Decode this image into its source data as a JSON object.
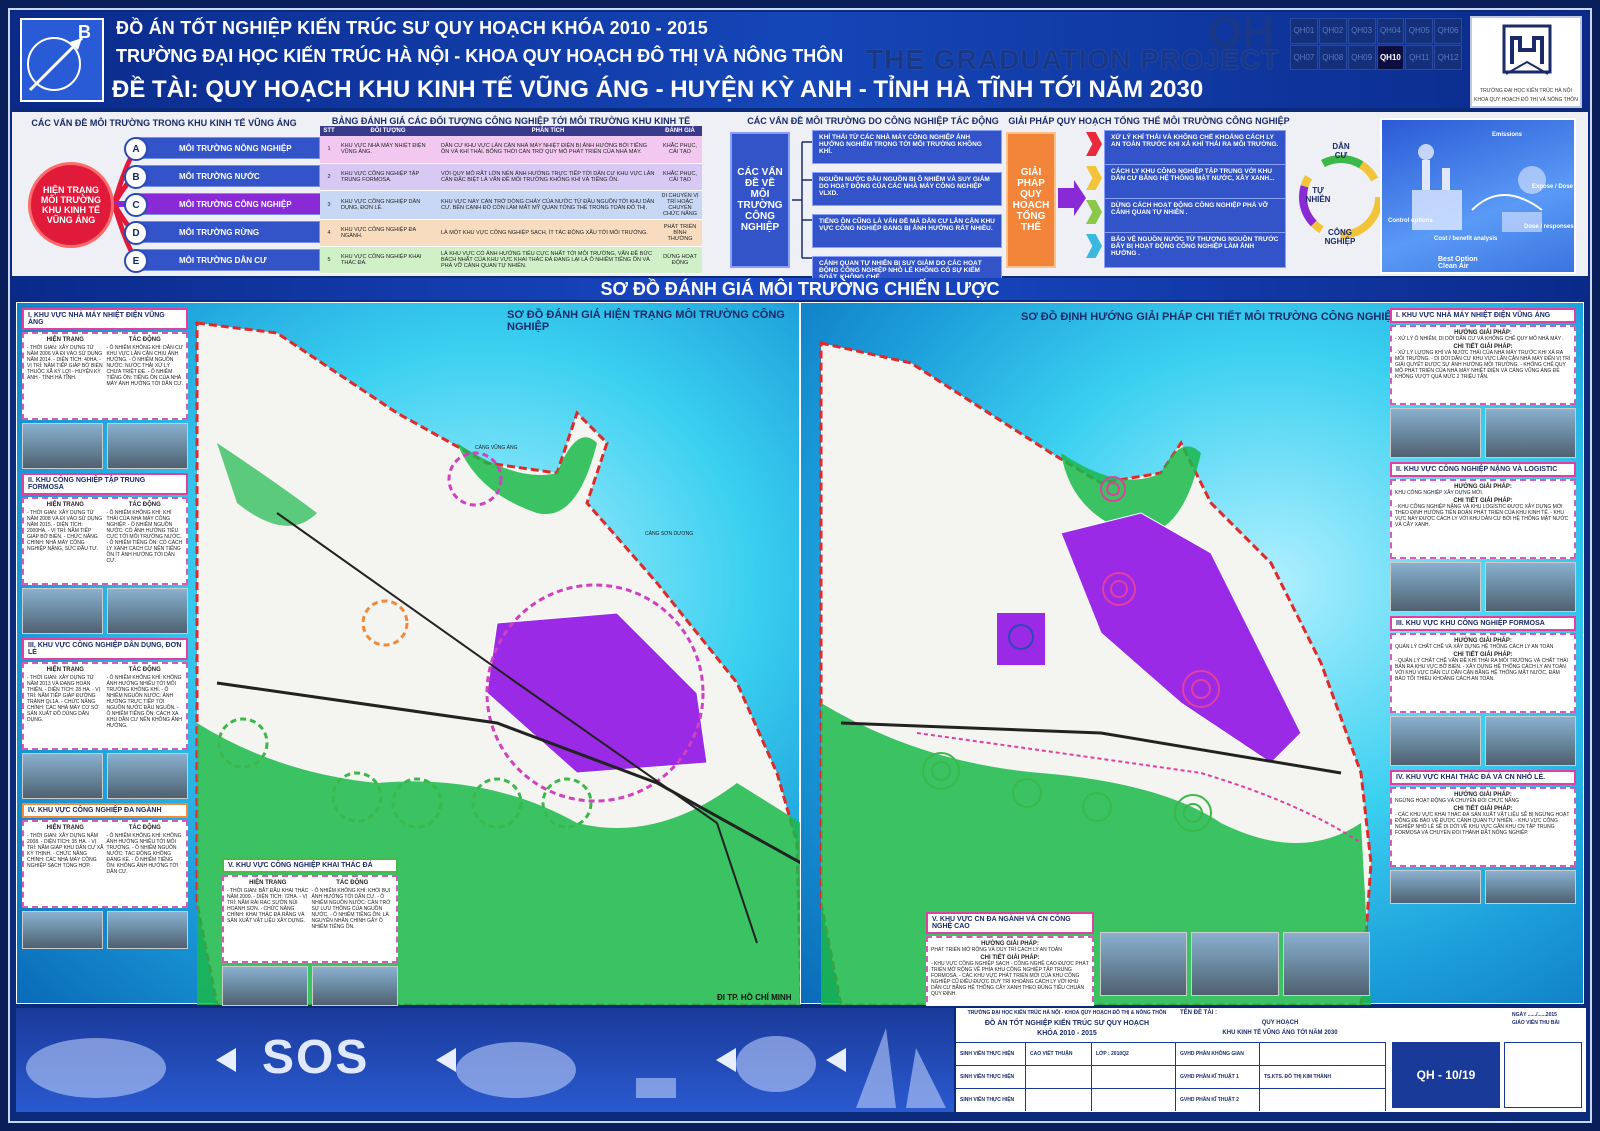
{
  "header": {
    "line1": "ĐỒ ÁN TỐT NGHIỆP KIẾN TRÚC SƯ QUY HOẠCH KHÓA 2010 - 2015",
    "line2": "TRƯỜNG ĐẠI HỌC KIẾN TRÚC HÀ NỘI - KHOA QUY HOẠCH ĐÔ THỊ VÀ NÔNG THÔN",
    "line3": "ĐỀ TÀI: QUY HOẠCH KHU KINH TẾ VŨNG ÁNG - HUYỆN KỲ ANH - TỈNH HÀ TĨNH TỚI NĂM 2030",
    "watermark": "THE GRADUATION PROJECT",
    "watermark_qh": "QH",
    "compass_letter": "B",
    "sheets": [
      "QH01",
      "QH02",
      "QH03",
      "QH04",
      "QH05",
      "QH06",
      "QH07",
      "QH08",
      "QH09",
      "QH10",
      "QH11",
      "QH12"
    ],
    "active_sheet": "QH10",
    "logo_caption1": "TRƯỜNG ĐẠI HỌC KIẾN TRÚC HÀ NỘI",
    "logo_caption2": "KHOA QUY HOẠCH ĐÔ THỊ VÀ NÔNG THÔN"
  },
  "issues_panel": {
    "title": "CÁC VẤN ĐỀ MÔI TRƯỜNG TRONG KHU KINH TẾ VŨNG ÁNG",
    "center": "HIỆN TRẠNG MÔI TRƯỜNG KHU KINH TẾ VŨNG ÁNG",
    "items": [
      {
        "letter": "A",
        "label": "MÔI TRƯỜNG NÔNG NGHIỆP"
      },
      {
        "letter": "B",
        "label": "MÔI TRƯỜNG NƯỚC"
      },
      {
        "letter": "C",
        "label": "MÔI TRƯỜNG CÔNG NGHIỆP"
      },
      {
        "letter": "D",
        "label": "MÔI TRƯỜNG RỪNG"
      },
      {
        "letter": "E",
        "label": "MÔI TRƯỜNG DÂN CƯ"
      }
    ]
  },
  "assessment_table": {
    "title": "BẢNG ĐÁNH GIÁ CÁC ĐỐI TƯỢNG CÔNG NGHIỆP TỚI MÔI TRƯỜNG KHU KINH TẾ VŨNG ÁNG",
    "headers": [
      "STT",
      "ĐỐI TƯỢNG",
      "PHÂN TÍCH",
      "ĐÁNH GIÁ"
    ],
    "rows": [
      {
        "stt": "1",
        "subject": "KHU VỰC NHÀ MÁY NHIỆT ĐIỆN VŨNG ÁNG.",
        "analysis": "DÂN CƯ KHU VỰC LÂN CẬN NHÀ MÁY NHIỆT ĐIỆN BỊ ẢNH HƯỞNG BỞI TIẾNG ỒN VÀ KHÍ THẢI. BỐNG THỜI CÁN TRỞ QUY MÔ PHÁT TRIỂN CỦA NHÀ MÁY.",
        "eval": "KHẮC PHỤC, CẢI TẠO",
        "color": "#f2c8f0"
      },
      {
        "stt": "2",
        "subject": "KHU VỰC CÔNG NGHIỆP TẬP TRUNG FORMOSA.",
        "analysis": "VỚI QUY MÔ RẤT LỚN NÊN ẢNH HƯỞNG TRỰC TIẾP TỚI DÂN CƯ KHU VỰC LÂN CẬN ĐẶC BIỆT LÀ VẤN ĐỀ MÔI TRƯỜNG KHÔNG KHÍ VÀ TIẾNG ỒN.",
        "eval": "KHẮC PHỤC, CẢI TẠO",
        "color": "#d8c8f4"
      },
      {
        "stt": "3",
        "subject": "KHU VỰC CÔNG NGHIỆP DÂN DỤNG, ĐƠN LẺ.",
        "analysis": "KHU VỰC NÀY CÁN TRỞ DÒNG CHẢY CỦA NƯỚC TỪ ĐẦU NGUỒN TỚI KHU DÂN CƯ. BÊN CẠNH ĐÓ CÒN LÀM MẤT MỸ QUAN TỔNG THỂ TRONG TOÀN ĐÔ THỊ.",
        "eval": "DI CHUYỂN VỊ TRÍ HOẶC CHUYỂN CHỨC NĂNG",
        "color": "#c8d8f4"
      },
      {
        "stt": "4",
        "subject": "KHU VỰC CÔNG NGHIỆP ĐA NGÀNH.",
        "analysis": "LÀ MỘT KHU VỰC CÔNG NGHIỆP SẠCH, ÍT TÁC ĐỘNG XẤU TỚI MÔI TRƯỜNG.",
        "eval": "PHÁT TRIỂN BÌNH THƯỜNG",
        "color": "#f8dcc0"
      },
      {
        "stt": "5",
        "subject": "KHU VỰC CÔNG NGHIỆP KHAI THÁC ĐÁ.",
        "analysis": "LÀ KHU VỰC CÓ ẢNH HƯỞNG TIÊU CỰC NHẤT TỚI MÔI TRƯỜNG, VẤN ĐỀ BỨC BÁCH NHẤT CỦA KHU VỰC KHAI THÁC ĐÁ ĐANG LẠI LÀ Ô NHIỄM TIẾNG ỒN VÀ PHÁ VỠ CẢNH QUAN TỰ NHIÊN.",
        "eval": "DỪNG HOẠT ĐỘNG",
        "color": "#d0f0c8"
      }
    ]
  },
  "industrial_issues": {
    "title": "CÁC VẤN ĐỀ MÔI TRƯỜNG DO CÔNG NGHIỆP TÁC ĐỘNG",
    "center": "CÁC VẤN ĐỀ VỀ MÔI TRƯỜNG CÔNG NGHIỆP",
    "items": [
      "KHÍ THẢI TỪ CÁC NHÀ MÁY CÔNG NGHIỆP ẢNH HƯỞNG NGHIÊM TRỌNG TỚI MÔI TRƯỜNG KHÔNG KHÍ.",
      "NGUỒN NƯỚC ĐẦU NGUỒN BỊ Ô NHIỄM VÀ SUY GIẢM DO HOẠT ĐỘNG CỦA CÁC NHÀ MÁY CÔNG NGHIỆP VLXD.",
      "TIẾNG ỒN CŨNG LÀ VẤN ĐỀ MÀ DÂN CƯ LÂN CẬN KHU VỰC CÔNG NGHIỆP ĐANG BỊ ẢNH HƯỞNG RẤT NHIỀU.",
      "CẢNH QUAN TỰ NHIÊN BỊ SUY GIẢM DO CÁC HOẠT ĐỘNG CÔNG NGHIỆP NHỎ LẺ KHÔNG CÓ SỰ KIỂM SOÁT, KHÔNG CHẾ"
    ]
  },
  "solutions": {
    "title": "GIẢI PHÁP QUY HOẠCH TỔNG THỂ MÔI TRƯỜNG CÔNG NGHIỆP",
    "center": "GIẢI PHÁP QUY HOẠCH TỔNG THỂ",
    "items": [
      "XỬ LÝ KHÍ THẢI VÀ KHÔNG CHẾ KHOẢNG CÁCH LY AN TOÀN TRƯỚC KHI XẢ KHÍ THẢI RA MÔI TRƯỜNG.",
      "CÁCH LY KHU CÔNG NGHIỆP TẬP TRUNG VỚI KHU DÂN CƯ BẰNG HỆ THỐNG MẶT NƯỚC, XÂY XANH...",
      "DỪNG CÁCH HOẠT ĐỘNG CÔNG NGHIỆP PHÁ VỠ CẢNH QUAN TỰ NHIÊN .",
      "BẢO VỆ NGUỒN NƯỚC TỪ THƯỢNG NGUỒN TRƯỚC ĐẨY BỊ HOẠT ĐỘNG CÔNG NGHIỆP LÀM ẢNH HƯỞNG ."
    ],
    "cycle": [
      "DÂN CƯ",
      "TỰ NHIÊN",
      "CÔNG NGHIỆP"
    ]
  },
  "illustration_labels": {
    "a": "Emissions",
    "b": "Control options",
    "c": "Expose / Dose",
    "d": "Dose / responses",
    "e": "Cost / benefit analysis",
    "f": "Best Option Clean Air"
  },
  "section_title": "SƠ ĐỒ ĐÁNH GIÁ MÔI TRƯỜNG CHIẾN LƯỢC",
  "map_left": {
    "title": "SƠ ĐỒ ĐÁNH GIÁ HIỆN TRẠNG MÔI TRƯỜNG CÔNG NGHIỆP",
    "labels": {
      "port1": "CẢNG VŨNG ÁNG",
      "port2": "CẢNG SƠN DƯƠNG",
      "arrow": "ĐI TP. HỒ CHÍ MINH"
    }
  },
  "map_right": {
    "title": "SƠ ĐỒ ĐỊNH HƯỚNG GIẢI PHÁP CHI TIẾT MÔI TRƯỜNG CÔNG NGHIỆP"
  },
  "left_cards": [
    {
      "title": "I. KHU VỰC NHÀ MÁY NHIỆT ĐIỆN VŨNG ÁNG",
      "col1": "HIỆN TRẠNG",
      "col2": "TÁC ĐỘNG",
      "text1": "- THỜI GIAN: XÂY DỰNG TỪ NĂM 2006 VÀ ĐI VÀO SỬ DỤNG NĂM 2014. - DIỆN TÍCH: 40HA. - VỊ TRÍ: NẰM TIẾP GIÁP BỜ BIỂN THUỘC XÃ KỲ LỢI - HUYỆN KỲ ANH - TỈNH HÀ TĨNH.",
      "text2": "- Ô NHIỄM KHÔNG KHÍ: DÂN CƯ KHU VỰC LÂN CẬN CHỊU ẢNH HƯỞNG. - Ô NHIỄM NGUỒN NƯỚC: NƯỚC THẢI XỬ LÝ CHƯA TRIỆT ĐỂ. - Ô NHIỄM TIẾNG ỒN: TIẾNG ỒN CỦA NHÀ MÁY ẢNH HƯỞNG TỚI DÂN CƯ.",
      "accent": "pink"
    },
    {
      "title": "II. KHU CÔNG NGHIỆP TẬP TRUNG FORMOSA",
      "col1": "HIỆN TRẠNG",
      "col2": "TÁC ĐỘNG",
      "text1": "- THỜI GIAN: XÂY DỰNG TỪ NĂM 2008 VÀ ĐI VÀO SỬ DỤNG NĂM 2015. - DIỆN TÍCH: 2000HA. - VỊ TRÍ: NẰM TIẾP GIÁP BỜ BIỂN. - CHỨC NĂNG CHÍNH: NHÀ MÁY CÔNG NGHIỆP NẶNG, SỨC ĐẦU TƯ.",
      "text2": "- Ô NHIỄM KHÔNG KHÍ: KHÍ THẢI CỦA NHÀ MÁY CÔNG NGHIỆP. - Ô NHIỄM NGUỒN NƯỚC: CÓ ẢNH HƯỞNG TIÊU CỰC TỚI MÔI TRƯỜNG NƯỚC. - Ô NHIỄM TIẾNG ỒN: CÓ CÁCH LY XANH CÁCH CƯ NÊN TIẾNG ỒN ÍT ẢNH HƯỞNG TỚI DÂN CƯ.",
      "accent": "pink"
    },
    {
      "title": "III. KHU VỰC CÔNG NGHIỆP DÂN DỤNG, ĐƠN LẺ",
      "col1": "HIỆN TRẠNG",
      "col2": "TÁC ĐỘNG",
      "text1": "- THỜI GIAN: XÂY DỰNG TỪ NĂM 2013 VÀ ĐANG HOÀN THIỆN. - DIỆN TÍCH: 28 HA. - VỊ TRÍ: NẰM TIẾP GIÁP ĐƯỜNG TRÁNH QL1A. - CHỨC NĂNG CHÍNH: CÁC NHÀ MÁY CƠ SỞ SẢN XUẤT ĐỒ DÙNG DÂN DỤNG.",
      "text2": "- Ô NHIỄM KHÔNG KHÍ: KHÔNG ẢNH HƯỞNG NHIỀU TỚI MÔI TRƯỜNG KHÔNG KHÍ. - Ô NHIỄM NGUỒN NƯỚC: ẢNH HƯỞNG TRỰC TIẾP TỚI NGUỒN NƯỚC ĐẦU NGUỒN. - Ô NHIỄM TIẾNG ỒN: CÁCH XA KHU DÂN CƯ NÊN KHÔNG ẢNH HƯỞNG.",
      "accent": "pink"
    },
    {
      "title": "IV. KHU VỰC CÔNG NGHIỆP ĐA NGÀNH",
      "col1": "HIỆN TRẠNG",
      "col2": "TÁC ĐỘNG",
      "text1": "- THỜI GIAN: XÂY DỰNG NĂM 2008. - DIỆN TÍCH: 35 HA. - VỊ TRÍ: NẰM GIÁP KHU DÂN CƯ XÃ KỲ THỊNH. - CHỨC NĂNG CHÍNH: CÁC NHÀ MÁY CÔNG NGHIỆP SẠCH TỔNG HỢP.",
      "text2": "- Ô NHIỄM KHÔNG KHÍ: KHÔNG ẢNH HƯỞNG NHIỀU TỚI MÔI TRƯỜNG. - Ô NHIỄM NGUỒN NƯỚC: TÁC ĐỘNG KHÔNG ĐÁNG KỂ. - Ô NHIỄM TIẾNG ỒN: KHÔNG ẢNH HƯỞNG TỚI DÂN CƯ.",
      "accent": "orange"
    },
    {
      "title": "V. KHU VỰC CÔNG NGHIỆP KHAI THÁC ĐÁ",
      "col1": "HIỆN TRẠNG",
      "col2": "TÁC ĐỘNG",
      "text1": "- THỜI GIAN: BẮT ĐẦU KHAI THÁC NĂM 2009. - DIỆN TÍCH: 72HA. - VỊ TRÍ: NẰM RẢI RÁC SƯỜN NÚI HOÀNH SƠN. - CHỨC NĂNG CHÍNH: KHAI THÁC ĐÁ RĂNG VÀ SẢN XUẤT VẬT LIỆU XÂY DỰNG.",
      "text2": "- Ô NHIỄM KHÔNG KHÍ: KHÓI BỤI ẢNH HƯỞNG TỚI DÂN CƯ. - Ô NHIỄM NGUỒN NƯỚC: CẢN TRỞ SỰ LƯU THÔNG CỦA NGUỒN NƯỚC. - Ô NHIỄM TIẾNG ỒN: LÀ NGUYÊN NHÂN CHÍNH GÂY Ô NHIỄM TIẾNG ỒN.",
      "accent": "green"
    }
  ],
  "right_cards": [
    {
      "title": "I. KHU VỰC NHÀ MÁY NHIỆT ĐIỆN VŨNG ÁNG",
      "h1": "HƯỚNG GIẢI PHÁP:",
      "t1": "- XỬ LÝ Ô NHIỄM, DI DỜI DÂN CƯ VÀ KHỐNG CHẾ QUY MÔ NHÀ MÁY .",
      "h2": "CHI TIẾT GIẢI PHÁP:",
      "t2": "- XỬ LÝ LƯỢNG KHÍ VÀ NƯỚC THẢI CỦA NHÀ MÁY TRƯỚC KHI XẢ RA MÔI TRƯỜNG. - DI DỜI DÂN CƯ KHU VỰC LÂN CẬN NHÀ MÁY ĐẾN VỊ TRÍ GIẢI QUYẾT ĐƯỢC SỰ ẢNH HƯỞNG MÔI TRƯỜNG. - KHỐNG CHẾ QUY MÔ PHÁT TRIỂN CỦA NHÀ MÁY NHIỆT ĐIỆN VÀ CẢNG VŨNG ÁNG ĐỂ KHÔNG VƯỢT QUÁ MỨC 2 TRIỆU TẤN."
    },
    {
      "title": "II. KHU VỰC CÔNG NGHIỆP NẶNG VÀ LOGISTIC",
      "h1": "HƯỚNG GIẢI PHÁP:",
      "t1": "KHU CÔNG NGHIỆP XÂY DỰNG MỚI.",
      "h2": "CHI TIẾT GIẢI PHÁP:",
      "t2": "- KHU CÔNG NGHIỆP NẶNG VÀ KHU LOGISTIC ĐƯỢC XÂY DỰNG MỚI THEO ĐỊNH HƯỚNG TIÊN ĐOÁN PHÁT TRIỂN CỦA KHU KINH TẾ. - KHU VỰC NÀY ĐƯỢC CÁCH LY VỚI KHU DÂN CƯ BỞI HỆ THỐNG MẶT NƯỚC VÀ CÂY XANH."
    },
    {
      "title": "III. KHU VỰC KHU CÔNG NGHIỆP FORMOSA",
      "h1": "HƯỚNG GIẢI PHÁP:",
      "t1": "QUẢN LÝ CHẤT CHẼ VÀ XÂY DỰNG HỆ THỐNG CÁCH LY AN TOÀN",
      "h2": "CHI TIẾT GIẢI PHÁP:",
      "t2": "- QUẢN LÝ CHẤT CHẼ VẤN ĐỀ KHÍ THẢI RA MÔI TRƯỜNG VÀ CHẤT THẢI BẢN RA KHU VỰC BỜ BIỂN. - XÂY DỰNG HỆ THỐNG CÁCH LY AN TOÀN VỚI KHU VỰC DÂN CƯ DẦN CẬN BẰNG HỆ THỐNG MẶT NƯỚC, ĐẢM BẢO TỐI THIỂU KHOẢNG CÁCH AN TOÀN."
    },
    {
      "title": "IV. KHU VỰC KHAI THÁC ĐÁ VÀ CN NHỎ LẺ.",
      "h1": "HƯỚNG GIẢI PHÁP:",
      "t1": "NGỪNG HOẠT ĐỘNG VÀ CHUYỂN ĐỔI CHỨC NĂNG",
      "h2": "CHI TIẾT GIẢI PHÁP:",
      "t2": "- CÁC KHU VỰC KHAI THÁC ĐÁ SẢN XUẤT VẬT LIỆU SẼ BỊ NGỪNG HOẠT ĐỘNG ĐỂ BẢO VỆ ĐƯỢC CẢNH QUAN TỰ NHIÊN. - KHU VỰC CÔNG NGHIỆP NHỎ LẺ SẼ DI DỜI VỀ KHU VỰC GẦN KHU CN TẬP TRUNG FORMOSA VÀ CHUYỂN ĐỔI THÀNH ĐẤT NÔNG NGHIỆP."
    },
    {
      "title": "V. KHU VỰC CN ĐA NGÀNH VÀ CN CÔNG NGHỆ CAO",
      "h1": "HƯỚNG GIẢI PHÁP:",
      "t1": "PHÁT TRIỂN MỞ RỘNG VÀ DUY TRÌ CÁCH LY AN TOÀN",
      "h2": "CHI TIẾT GIẢI PHÁP:",
      "t2": "- KHU VỰC CÔNG NGHIỆP SẠCH - CÔNG NGHỆ CAO ĐƯỢC PHÁT TRIỂN MỞ RỘNG VỀ PHÍA KHU CÔNG NGHIỆP TẬP TRUNG FORMOSA. - CÁC KHU VỰC PHÁT TRIỂN MỚI CỦA KHU CÔNG NGHIỆP CŨ ĐIỀU ĐƯỢC DUY TRÌ KHOẢNG CÁCH LY VỚI KHU DÂN CƯ BẰNG HỆ THỐNG CÂY XANH THEO ĐÚNG TIÊU CHUẨN QUY ĐỊNH."
    }
  ],
  "footer": {
    "school": "TRƯỜNG ĐẠI HỌC KIẾN TRÚC HÀ NỘI - KHOA QUY HOẠCH ĐÔ THỊ & NÔNG THÔN",
    "project": "ĐỒ ÁN TỐT NGHIỆP KIẾN TRÚC SƯ QUY HOẠCH",
    "course": "KHÓA 2010 - 2015",
    "topic_label": "TÊN ĐỀ TÀI :",
    "topic1": "QUY HOẠCH",
    "topic2": "KHU KINH TẾ VŨNG ÁNG TỚI NĂM 2030",
    "date": "NGÀY ....../......2015",
    "teacher": "GIÁO VIÊN THU BÀI",
    "rows": [
      {
        "a": "SINH VIÊN THỰC HIỆN",
        "b": "CAO VIẾT THUẬN",
        "c": "LỚP : 2010Q2",
        "d": "GVHD PHẦN KHÔNG GIAN",
        "e": ""
      },
      {
        "a": "SINH VIÊN THỰC HIỆN",
        "b": "",
        "c": "",
        "d": "GVHD PHẦN KĨ THUẬT 1",
        "e": "TS.KTS. ĐỖ THỊ KIM THÀNH"
      },
      {
        "a": "SINH VIÊN THỰC HIỆN",
        "b": "",
        "c": "",
        "d": "GVHD PHẦN KĨ THUẬT 2",
        "e": ""
      }
    ],
    "sheet_no": "QH - 10/19",
    "sos": "SOS"
  }
}
